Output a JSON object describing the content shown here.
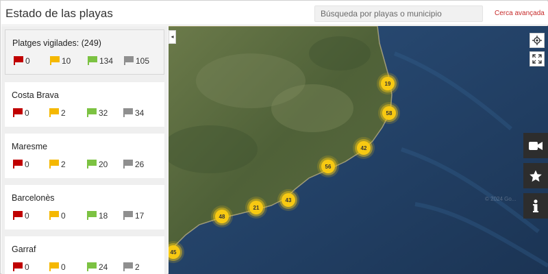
{
  "header": {
    "title": "Estado de las playas",
    "search_placeholder": "Búsqueda por playas o municipio",
    "advanced_link": "Cerca avançada"
  },
  "colors": {
    "red_flag": "#c00000",
    "yellow_flag": "#f5b800",
    "green_flag": "#7cc242",
    "grey_flag": "#8f8f8f",
    "marker": "#f7c912",
    "accent": "#c62828"
  },
  "summary": {
    "title": "Platges vigilades: (249)",
    "red": "0",
    "yellow": "10",
    "green": "134",
    "grey": "105"
  },
  "regions": [
    {
      "name": "Costa Brava",
      "red": "0",
      "yellow": "2",
      "green": "32",
      "grey": "34"
    },
    {
      "name": "Maresme",
      "red": "0",
      "yellow": "2",
      "green": "20",
      "grey": "26"
    },
    {
      "name": "Barcelonès",
      "red": "0",
      "yellow": "0",
      "green": "18",
      "grey": "17"
    },
    {
      "name": "Garraf",
      "red": "0",
      "yellow": "0",
      "green": "24",
      "grey": "2"
    }
  ],
  "map": {
    "collapse_icon": "◂",
    "clusters": [
      "19",
      "58",
      "42",
      "56",
      "43",
      "21",
      "48",
      "45"
    ],
    "controls": [
      "locate-icon",
      "fullscreen-icon"
    ],
    "side_buttons": [
      "video-camera-icon",
      "star-icon",
      "info-icon"
    ],
    "watermark": "© 2024 Go..."
  }
}
